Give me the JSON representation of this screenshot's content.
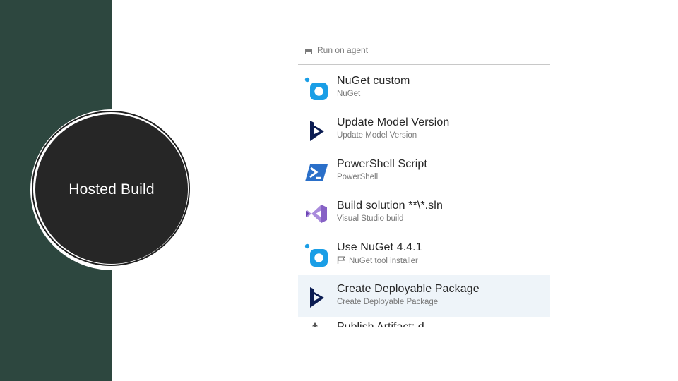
{
  "slide": {
    "circle_label": "Hosted Build"
  },
  "panel": {
    "top_cut_text": "Run on agent",
    "tasks": [
      {
        "title": "NuGet custom",
        "subtitle": "NuGet",
        "icon": "nuget-icon"
      },
      {
        "title": "Update Model Version",
        "subtitle": "Update Model Version",
        "icon": "dynamics-icon"
      },
      {
        "title": "PowerShell Script",
        "subtitle": "PowerShell",
        "icon": "powershell-icon"
      },
      {
        "title": "Build solution **\\*.sln",
        "subtitle": "Visual Studio build",
        "icon": "visual-studio-icon"
      },
      {
        "title": "Use NuGet 4.4.1",
        "subtitle": "NuGet tool installer",
        "icon": "nuget-icon"
      },
      {
        "title": "Create Deployable Package",
        "subtitle": "Create Deployable Package",
        "icon": "dynamics-icon",
        "selected": true
      }
    ],
    "bottom_cut_text": "Publish Artifact: d"
  },
  "colors": {
    "band": "#2d473f",
    "circle": "#262626",
    "selected_row": "#eef4f9",
    "nuget_blue": "#1a9ee6",
    "dynamics_navy": "#0b1c52",
    "powershell_blue": "#2a6fc9",
    "vs_purple": "#8661c5"
  }
}
